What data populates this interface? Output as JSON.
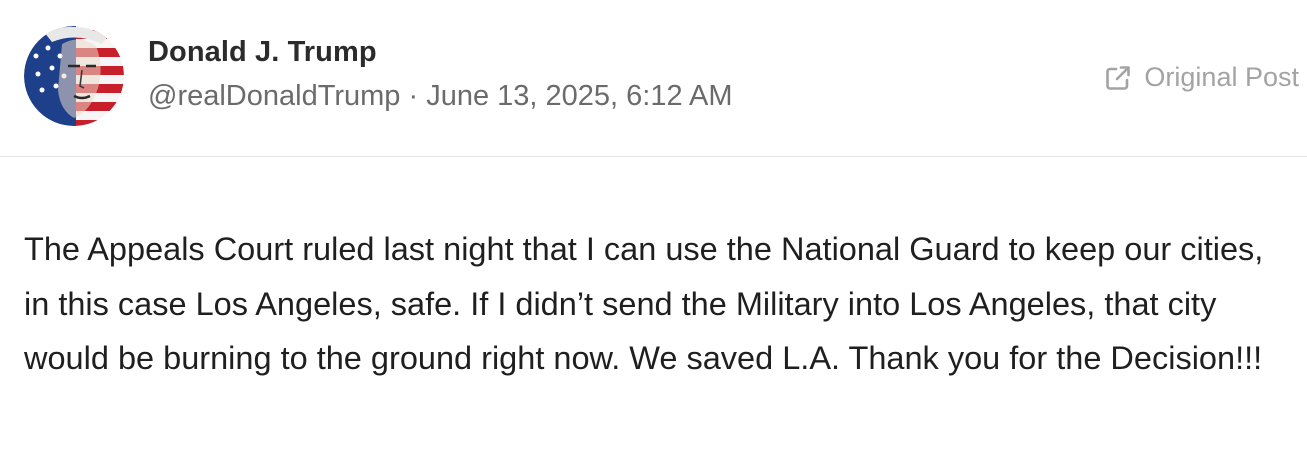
{
  "post": {
    "author": {
      "display_name": "Donald J. Trump",
      "handle": "@realDonaldTrump"
    },
    "separator": "·",
    "timestamp": "June 13, 2025, 6:12 AM",
    "original_link": {
      "label": "Original Post",
      "icon": "external-link-icon"
    },
    "body": "The Appeals Court ruled last night that I can use the National Guard to keep our cities, in this case Los Angeles, safe. If I didn’t send the Military into Los Angeles, that city would be burning to the ground right now. We saved L.A. Thank you for the Decision!!!"
  },
  "colors": {
    "name": "#2b2b2b",
    "meta": "#6b6b6b",
    "link": "#a3a3a3",
    "body": "#1f1f1f",
    "divider": "#e6e6e6",
    "avatar_blue": "#1e3f8a",
    "avatar_red": "#c8202b"
  }
}
